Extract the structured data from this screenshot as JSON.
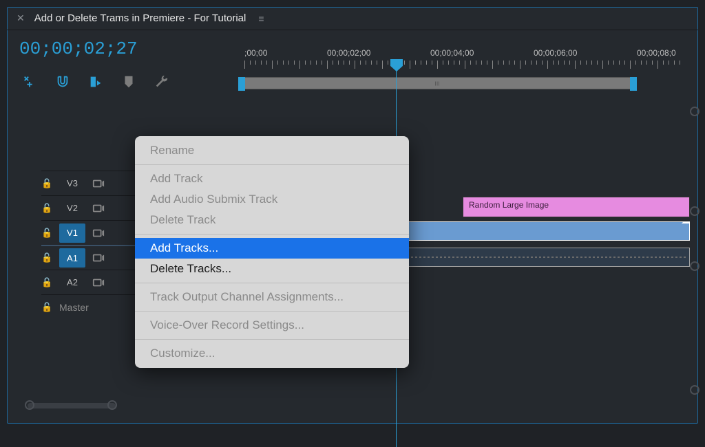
{
  "sequence_title": "Add or Delete Trams in Premiere - For Tutorial",
  "timecode": "00;00;02;27",
  "ruler_labels": [
    ";00;00",
    "00;00;02;00",
    "00;00;04;00",
    "00;00;06;00",
    "00;00;08;0"
  ],
  "tracks": {
    "v3": {
      "label": "V3"
    },
    "v2": {
      "label": "V2"
    },
    "v1": {
      "label": "V1"
    },
    "a1": {
      "label": "A1"
    },
    "a2": {
      "label": "A2"
    },
    "master": {
      "label": "Master"
    }
  },
  "clips": {
    "pink_label": "Random Large Image"
  },
  "context_menu": {
    "rename": "Rename",
    "add_track": "Add Track",
    "add_submix": "Add Audio Submix Track",
    "delete_track": "Delete Track",
    "add_tracks": "Add Tracks...",
    "delete_tracks": "Delete Tracks...",
    "output_assign": "Track Output Channel Assignments...",
    "vo_settings": "Voice-Over Record Settings...",
    "customize": "Customize..."
  },
  "colors": {
    "accent": "#2d8ceb",
    "clip_pink": "#e68be0",
    "clip_blue": "#6a9bd1"
  }
}
